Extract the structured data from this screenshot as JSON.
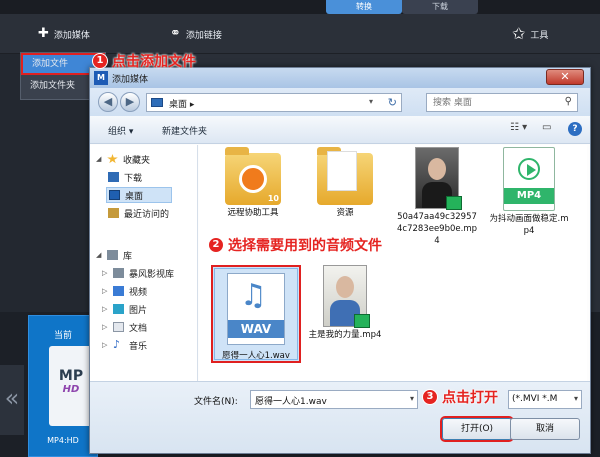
{
  "app": {
    "mode_tabs": [
      "转换",
      "下载"
    ],
    "toolbar": {
      "add_media": "添加媒体",
      "add_link": "添加链接",
      "tools": "工具"
    },
    "add_menu": [
      "添加文件",
      "添加文件夹"
    ],
    "strip": {
      "current_label": "当前",
      "thumb_text": "MP",
      "thumb_sub": "HD",
      "format_label": "MP4:HD",
      "nav_glyph": "«"
    }
  },
  "dialog": {
    "title": "添加媒体",
    "address": {
      "crumb": "桌面",
      "arrow": "▸"
    },
    "search_placeholder": "搜索 桌面",
    "commands": {
      "organize": "组织 ▾",
      "new_folder": "新建文件夹"
    },
    "nav": {
      "favorites": "收藏夹",
      "downloads": "下载",
      "desktop": "桌面",
      "recent": "最近访问的",
      "libraries": "库",
      "storm": "暴风影视库",
      "videos": "视频",
      "pictures": "图片",
      "documents": "文档",
      "music": "音乐"
    },
    "files": [
      {
        "name": "远程协助工具"
      },
      {
        "name": "资源"
      },
      {
        "name": "50a47aa49c329574c7283ee9b0e.mp4"
      },
      {
        "name": "为抖动画面做稳定.mp4"
      },
      {
        "name": "愿得一人心1.wav"
      },
      {
        "name": "主是我的力量.mp4"
      }
    ],
    "icon_tags": {
      "mp4": "MP4",
      "wav": "WAV",
      "ten": "10"
    },
    "filename_label": "文件名(N):",
    "filename_value": "愿得一人心1.wav",
    "filetype_value": "(*.MVI *.M",
    "open_button": "打开(O)",
    "cancel_button": "取消"
  },
  "annotations": [
    {
      "num": "1",
      "text": "点击添加文件"
    },
    {
      "num": "2",
      "text": "选择需要用到的音频文件"
    },
    {
      "num": "3",
      "text": "点击打开"
    }
  ]
}
